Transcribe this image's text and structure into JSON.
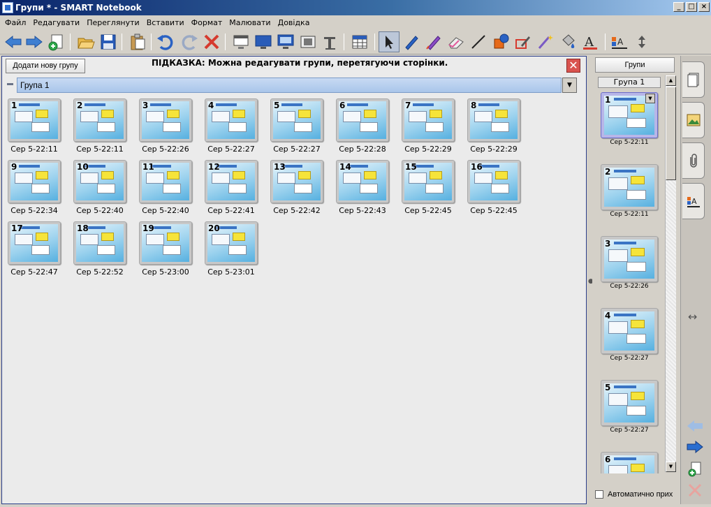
{
  "window": {
    "title": "Групи * - SMART Notebook"
  },
  "menu": [
    "Файл",
    "Редагувати",
    "Переглянути",
    "Вставити",
    "Формат",
    "Малювати",
    "Довідка"
  ],
  "main": {
    "add_group_label": "Додати нову групу",
    "hint": "ПІДКАЗКА: Можна редагувати групи, перетягуючи сторінки.",
    "group_name": "Група 1",
    "pages": [
      {
        "num": "1",
        "time": "Сер 5-22:11"
      },
      {
        "num": "2",
        "time": "Сер 5-22:11"
      },
      {
        "num": "3",
        "time": "Сер 5-22:26"
      },
      {
        "num": "4",
        "time": "Сер 5-22:27"
      },
      {
        "num": "5",
        "time": "Сер 5-22:27"
      },
      {
        "num": "6",
        "time": "Сер 5-22:28"
      },
      {
        "num": "7",
        "time": "Сер 5-22:29"
      },
      {
        "num": "8",
        "time": "Сер 5-22:29"
      },
      {
        "num": "9",
        "time": "Сер 5-22:34"
      },
      {
        "num": "10",
        "time": "Сер 5-22:40"
      },
      {
        "num": "11",
        "time": "Сер 5-22:40"
      },
      {
        "num": "12",
        "time": "Сер 5-22:41"
      },
      {
        "num": "13",
        "time": "Сер 5-22:42"
      },
      {
        "num": "14",
        "time": "Сер 5-22:43"
      },
      {
        "num": "15",
        "time": "Сер 5-22:45"
      },
      {
        "num": "16",
        "time": "Сер 5-22:45"
      },
      {
        "num": "17",
        "time": "Сер 5-22:47"
      },
      {
        "num": "18",
        "time": "Сер 5-22:52"
      },
      {
        "num": "19",
        "time": "Сер 5-23:00"
      },
      {
        "num": "20",
        "time": "Сер 5-23:01"
      }
    ]
  },
  "sorter": {
    "groups_label": "Групи",
    "group_name": "Група 1",
    "pages": [
      {
        "num": "1",
        "time": "Сер 5-22:11"
      },
      {
        "num": "2",
        "time": "Сер 5-22:11"
      },
      {
        "num": "3",
        "time": "Сер 5-22:26"
      },
      {
        "num": "4",
        "time": "Сер 5-22:27"
      },
      {
        "num": "5",
        "time": "Сер 5-22:27"
      },
      {
        "num": "6",
        "time": ""
      }
    ],
    "autohide_label": "Автоматично прих"
  },
  "colors": {
    "accent": "#0a246a",
    "group_bar": "#b5cff0",
    "close": "#d9534f"
  }
}
